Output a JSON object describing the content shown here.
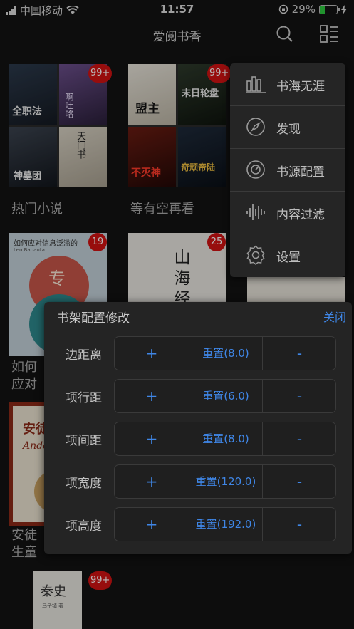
{
  "status": {
    "carrier": "中国移动",
    "time": "11:57",
    "battery": "29%",
    "battery_fraction": 0.29
  },
  "navbar": {
    "title": "爱阅书香"
  },
  "books": [
    {
      "name": "热门小说",
      "badge": "99+"
    },
    {
      "name": "等有空再看",
      "badge": "99+"
    },
    {
      "name": "如何应对信息泛滥的",
      "badge": "19"
    },
    {
      "name": "",
      "badge": "25"
    },
    {
      "name": "",
      "badge": ""
    },
    {
      "name": "安徒生童话故事集",
      "badge": ""
    },
    {
      "name": "",
      "badge": "99+"
    }
  ],
  "covers": {
    "c1": [
      "全职法",
      "啊吐咯",
      "神墓团",
      "天门书"
    ],
    "c2": [
      "盟主",
      "末日轮盘",
      "不灭神",
      "奇顽帝陆"
    ],
    "c3": {
      "title": "如何应对信息泛滥的",
      "author": "Leo Babauta",
      "word": "专"
    },
    "c4": {
      "title": "山海经"
    },
    "c6": {
      "title": "安徒生",
      "sub": "Andersen"
    },
    "c7": {
      "title": "秦史",
      "sub": "马子镇 著"
    }
  },
  "menu": [
    "书海无涯",
    "发现",
    "书源配置",
    "内容过滤",
    "设置"
  ],
  "panel": {
    "title": "书架配置修改",
    "close": "关闭",
    "rows": [
      {
        "label": "边距离",
        "plus": "+",
        "reset": "重置(8.0)",
        "minus": "-"
      },
      {
        "label": "项行距",
        "plus": "+",
        "reset": "重置(6.0)",
        "minus": "-"
      },
      {
        "label": "项间距",
        "plus": "+",
        "reset": "重置(8.0)",
        "minus": "-"
      },
      {
        "label": "项宽度",
        "plus": "+",
        "reset": "重置(120.0)",
        "minus": "-"
      },
      {
        "label": "项高度",
        "plus": "+",
        "reset": "重置(192.0)",
        "minus": "-"
      }
    ]
  }
}
